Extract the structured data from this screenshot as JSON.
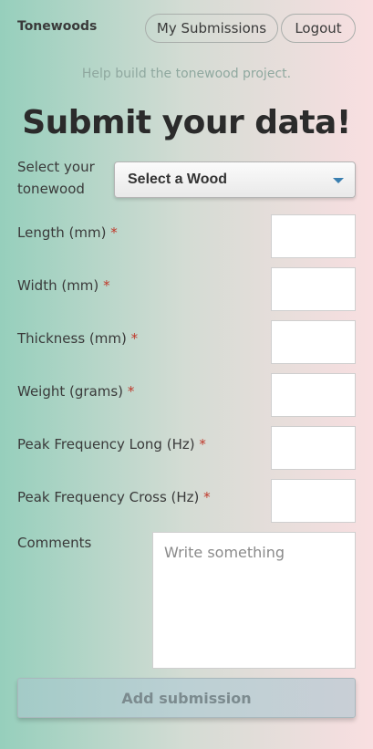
{
  "header": {
    "brand": "Tonewoods",
    "nav": {
      "submissions_label": "My Submissions",
      "logout_label": "Logout"
    }
  },
  "tagline": "Help build the tonewood project.",
  "title": "Submit your data!",
  "form": {
    "wood": {
      "label": "Select your tonewood",
      "selected": "Select a Wood"
    },
    "required_mark": "*",
    "fields": {
      "length": {
        "label": "Length (mm)",
        "value": ""
      },
      "width": {
        "label": "Width (mm)",
        "value": ""
      },
      "thickness": {
        "label": "Thickness (mm)",
        "value": ""
      },
      "weight": {
        "label": "Weight (grams)",
        "value": ""
      },
      "peak_long": {
        "label": "Peak Frequency Long (Hz)",
        "value": ""
      },
      "peak_cross": {
        "label": "Peak Frequency Cross (Hz)",
        "value": ""
      }
    },
    "comments": {
      "label": "Comments",
      "placeholder": "Write something",
      "value": ""
    },
    "submit_label": "Add submission"
  },
  "colors": {
    "gradient_left": "#96cfbc",
    "gradient_right": "#f9dfe1",
    "required": "#c0392b",
    "select_caret": "#3a7fb0"
  }
}
